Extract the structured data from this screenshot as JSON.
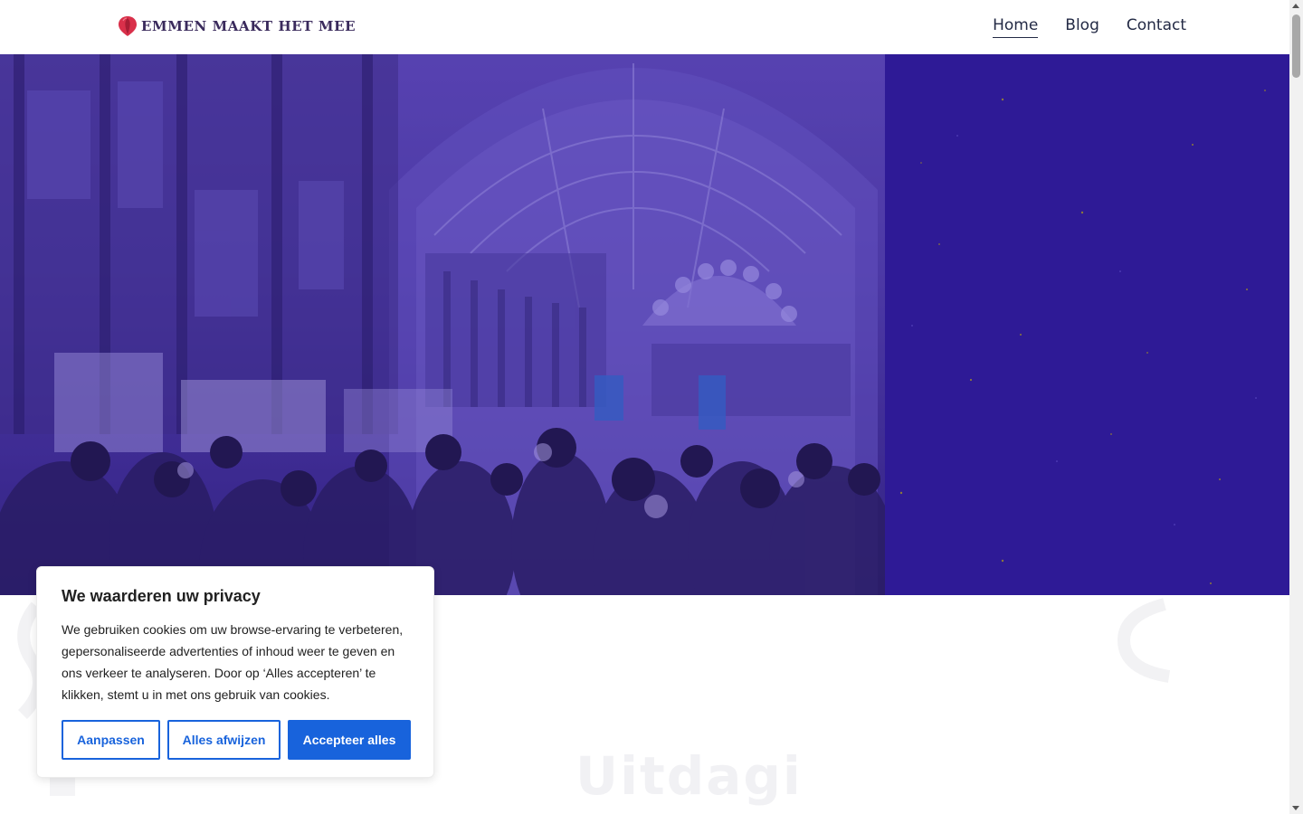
{
  "header": {
    "logo_text": "EMMEN MAAKT HET MEE",
    "nav": [
      {
        "label": "Home",
        "active": true
      },
      {
        "label": "Blog",
        "active": false
      },
      {
        "label": "Contact",
        "active": false
      }
    ]
  },
  "hero": {
    "overlay_color": "#4a36a8",
    "panel_color": "#2e1a96"
  },
  "cookie": {
    "title": "We waarderen uw privacy",
    "text": "We gebruiken cookies om uw browse-ervaring te verbeteren, gepersonaliseerde advertenties of inhoud weer te geven en ons verkeer te analyseren. Door op ‘Alles accepteren’ te klikken, stemt u in met ons gebruik van cookies.",
    "customize_label": "Aanpassen",
    "reject_label": "Alles afwijzen",
    "accept_label": "Accepteer alles",
    "accent_color": "#1863dc"
  },
  "below": {
    "faint_title": "Uitdagi"
  }
}
